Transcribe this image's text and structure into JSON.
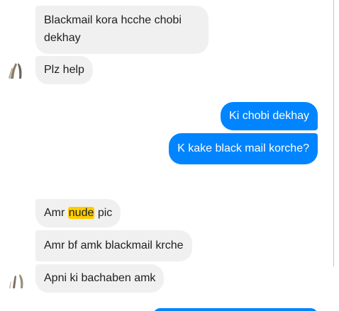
{
  "colors": {
    "incoming_bg": "#f0f0f0",
    "outgoing_bg": "#0084ff",
    "highlight": "#ffcc00",
    "text_dark": "#1c1e21"
  },
  "messages": [
    {
      "from": "them",
      "text": "Blackmail kora hcche chobi dekhay"
    },
    {
      "from": "them",
      "text": "Plz help"
    },
    {
      "from": "me",
      "text": "Ki chobi dekhay"
    },
    {
      "from": "me",
      "text": "K kake black mail korche?"
    },
    {
      "from": "them",
      "before": "Amr",
      "highlight": "nude",
      "after": "pic"
    },
    {
      "from": "them",
      "text": "Amr bf amk blackmail krche"
    },
    {
      "from": "them",
      "text": "Apni ki bachaben amk"
    }
  ],
  "icons": {
    "avatar_1": "avatar-icon",
    "avatar_2": "avatar-icon"
  }
}
